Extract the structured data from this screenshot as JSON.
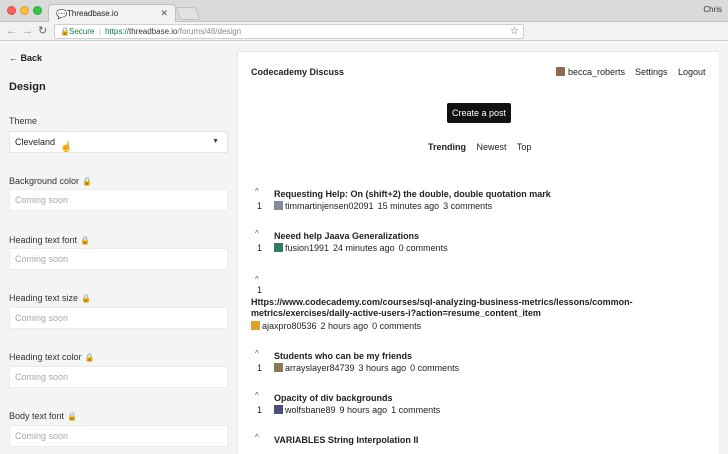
{
  "browser": {
    "tab_title": "Threadbase.io",
    "tab_close": "✕",
    "user": "Chris",
    "secure_label": "Secure",
    "url_scheme": "https://",
    "url_host": "threadbase.io",
    "url_path": "/forums/46/design"
  },
  "sidebar": {
    "back_label": "← Back",
    "title": "Design",
    "theme_label": "Theme",
    "theme_value": "Cleveland",
    "fields": [
      {
        "label": "Background color",
        "placeholder": "Coming soon"
      },
      {
        "label": "Heading text font",
        "placeholder": "Coming soon"
      },
      {
        "label": "Heading text size",
        "placeholder": "Coming soon"
      },
      {
        "label": "Heading text color",
        "placeholder": "Coming soon"
      },
      {
        "label": "Body text font",
        "placeholder": "Coming soon"
      }
    ]
  },
  "forum": {
    "brand": "Codecademy Discuss",
    "username": "becca_roberts",
    "settings_label": "Settings",
    "logout_label": "Logout",
    "create_label": "Create a post",
    "tabs": [
      "Trending",
      "Newest",
      "Top"
    ],
    "posts": [
      {
        "title": "Requesting Help: On (shift+2) the double, double quotation mark",
        "votes": "1",
        "author": "timmartinjensen02091",
        "time": "15 minutes ago",
        "comments": "3 comments"
      },
      {
        "title": "Neeed help Jaava Generalizations",
        "votes": "1",
        "author": "fusion1991",
        "time": "24 minutes ago",
        "comments": "0 comments"
      },
      {
        "title": "Https://www.codecademy.com/courses/sql-analyzing-business-metrics/lessons/common-metrics/exercises/daily-active-users-i?action=resume_content_item",
        "votes": "1",
        "author": "ajaxpro80536",
        "time": "2 hours ago",
        "comments": "0 comments"
      },
      {
        "title": "Students who can be my friends",
        "votes": "1",
        "author": "arrayslayer84739",
        "time": "3 hours ago",
        "comments": "0 comments"
      },
      {
        "title": "Opacity of div backgrounds",
        "votes": "1",
        "author": "wolfsbane89",
        "time": "9 hours ago",
        "comments": "1 comments"
      },
      {
        "title": "VARIABLES String Interpolation II",
        "votes": "",
        "author": "",
        "time": "",
        "comments": ""
      }
    ]
  }
}
